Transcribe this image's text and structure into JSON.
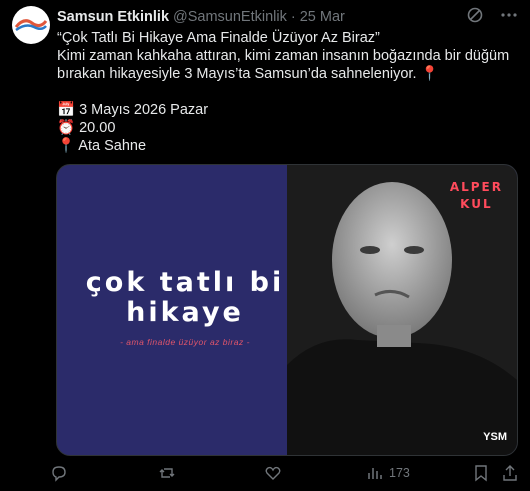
{
  "tweet": {
    "author_name": "Samsun Etkinlik",
    "handle": "@SamsunEtkinlik",
    "separator": "·",
    "time": "25 Mar",
    "lines": [
      "“Çok Tatlı Bi Hikaye Ama Finalde Üzüyor Az Biraz”",
      "Kimi zaman kahkaha attıran, kimi zaman insanın boğazında bir düğüm",
      "bırakan hikayesiyle 3 Mayıs’ta Samsun’da sahneleniyor. 📍"
    ],
    "details": [
      {
        "icon": "📅",
        "text": "3 Mayıs 2026 Pazar"
      },
      {
        "icon": "⏰",
        "text": "20.00"
      },
      {
        "icon": "📍",
        "text": "Ata Sahne"
      }
    ]
  },
  "poster": {
    "title_line1": "çok tatlı bi",
    "title_line2": "hikaye",
    "subtitle": "- ama finalde üzüyor az biraz -",
    "actor_line1": "ALPER",
    "actor_line2": "KUL",
    "logo": "YSM",
    "bg_color": "#2b2b6a"
  },
  "actions": {
    "views": "173"
  },
  "colors": {
    "background": "#000000",
    "text": "#e7e9ea",
    "muted": "#71767b",
    "accent_red": "#ff4b5c"
  }
}
